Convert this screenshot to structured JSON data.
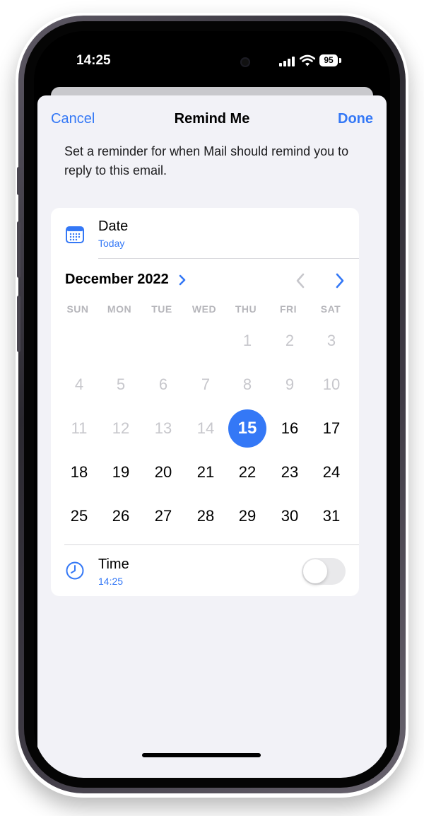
{
  "status_bar": {
    "time": "14:25",
    "battery": "95"
  },
  "nav": {
    "cancel": "Cancel",
    "title": "Remind Me",
    "done": "Done"
  },
  "description": "Set a reminder for when Mail should remind you to reply to this email.",
  "date_row": {
    "title": "Date",
    "value": "Today",
    "icon": "calendar-icon"
  },
  "calendar": {
    "month": "December 2022",
    "weekdays": [
      "SUN",
      "MON",
      "TUE",
      "WED",
      "THU",
      "FRI",
      "SAT"
    ],
    "weeks": [
      [
        "",
        "",
        "",
        "",
        "1",
        "2",
        "3"
      ],
      [
        "4",
        "5",
        "6",
        "7",
        "8",
        "9",
        "10"
      ],
      [
        "11",
        "12",
        "13",
        "14",
        "15",
        "16",
        "17"
      ],
      [
        "18",
        "19",
        "20",
        "21",
        "22",
        "23",
        "24"
      ],
      [
        "25",
        "26",
        "27",
        "28",
        "29",
        "30",
        "31"
      ]
    ],
    "selected_day": "15",
    "first_available_day": 15,
    "accent_color": "#3478f6",
    "disabled_color": "#c7c7cc"
  },
  "time_row": {
    "title": "Time",
    "value": "14:25",
    "icon": "clock-icon",
    "toggle_on": false
  }
}
